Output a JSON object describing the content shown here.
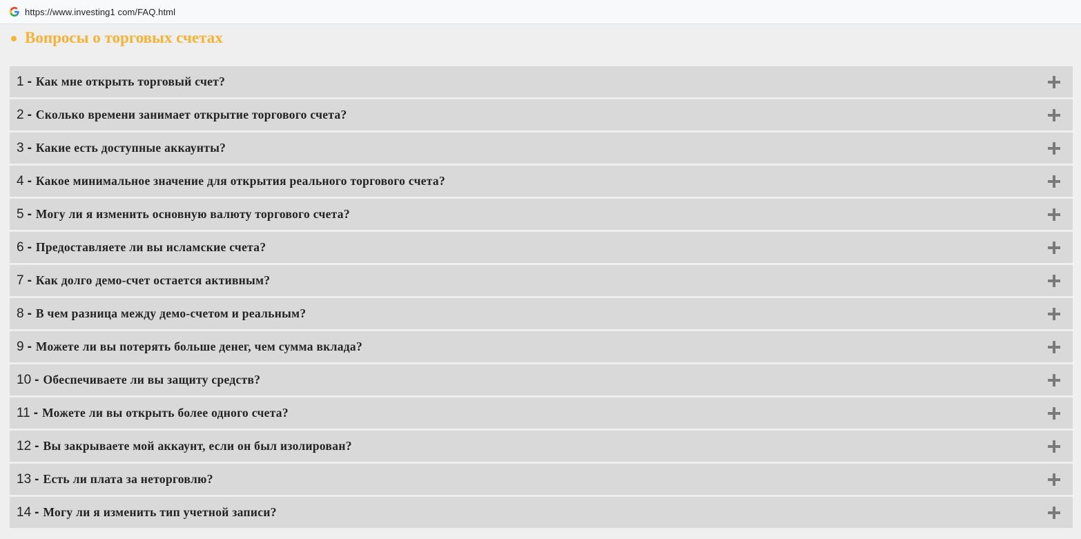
{
  "browser": {
    "url": "https://www.investing1 com/FAQ.html",
    "favicon": "google-g-icon"
  },
  "section": {
    "title": "Вопросы о торговых счетах",
    "accent_color": "#f5b335",
    "item_bg": "#d9d9d9",
    "icon_color": "#7a7a7a"
  },
  "faq": [
    {
      "num": "1",
      "sep": "-",
      "question": "Как мне открыть торговый счет?",
      "icon": "plus-icon"
    },
    {
      "num": "2",
      "sep": "-",
      "question": "Сколько времени занимает открытие торгового счета?",
      "icon": "plus-icon"
    },
    {
      "num": "3",
      "sep": "-",
      "question": "Какие есть доступные аккаунты?",
      "icon": "plus-icon"
    },
    {
      "num": "4",
      "sep": "-",
      "question": "Какое минимальное значение для открытия реального торгового счета?",
      "icon": "plus-icon"
    },
    {
      "num": "5",
      "sep": "-",
      "question": "Могу ли я изменить основную валюту торгового счета?",
      "icon": "plus-icon"
    },
    {
      "num": "6",
      "sep": "-",
      "question": "Предоставляете ли вы исламские счета?",
      "icon": "plus-icon"
    },
    {
      "num": "7",
      "sep": "-",
      "question": "Как долго демо-счет остается активным?",
      "icon": "plus-icon"
    },
    {
      "num": "8",
      "sep": "-",
      "question": "В чем разница между демо-счетом и реальным?",
      "icon": "plus-icon"
    },
    {
      "num": "9",
      "sep": "-",
      "question": "Можете ли вы потерять больше денег, чем сумма вклада?",
      "icon": "plus-icon"
    },
    {
      "num": "10",
      "sep": "-",
      "question": "Обеспечиваете ли вы защиту средств?",
      "icon": "plus-icon"
    },
    {
      "num": "11",
      "sep": "-",
      "question": "Можете ли вы открыть более одного счета?",
      "icon": "plus-icon"
    },
    {
      "num": "12",
      "sep": "-",
      "question": "Вы закрываете мой аккаунт, если он был изолирован?",
      "icon": "plus-icon"
    },
    {
      "num": "13",
      "sep": "-",
      "question": "Есть ли плата за неторговлю?",
      "icon": "plus-icon"
    },
    {
      "num": "14",
      "sep": "-",
      "question": "Могу ли я изменить тип учетной записи?",
      "icon": "plus-icon"
    }
  ]
}
